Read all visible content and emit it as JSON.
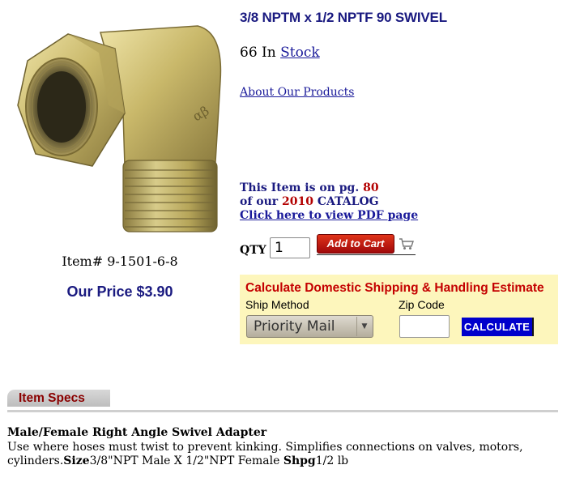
{
  "product": {
    "title": "3/8 NPTM x 1/2 NPTF 90 SWIVEL",
    "stock_count": "66 In",
    "stock_link": "Stock",
    "about_link": "About Our Products",
    "item_number": "Item# 9-1501-6-8",
    "price": "Our Price $3.90"
  },
  "catalog": {
    "line1_prefix": "This Item is on  pg.",
    "page": "80",
    "line2_prefix": "of our",
    "year": "2010",
    "line2_suffix": "CATALOG",
    "pdf_link": "Click here to view PDF page"
  },
  "cart": {
    "qty_label": "QTY",
    "qty_value": "1",
    "add_to_cart_label": "Add to Cart"
  },
  "shipping": {
    "title": "Calculate Domestic Shipping & Handling Estimate",
    "method_label": "Ship Method",
    "zip_label": "Zip Code",
    "method_value": "Priority Mail",
    "zip_value": "",
    "calculate_label": "CALCULATE"
  },
  "specs": {
    "tab_label": "Item Specs",
    "heading": "Male/Female Right Angle Swivel Adapter",
    "description": "Use where hoses must twist to prevent kinking. Simplifies connections on valves, motors, cylinders.",
    "size_label": "Size",
    "size_value": "3/8\"NPT Male X 1/2\"NPT Female",
    "shpg_label": "Shpg",
    "shpg_value": "1/2 lb"
  },
  "colors": {
    "title_blue": "#1a1a80",
    "catalog_red": "#b30000",
    "ship_panel_bg": "#fdf6bc",
    "ship_title_red": "#c40000",
    "calculate_bg": "#0000cc",
    "tab_text": "#8a0000"
  },
  "icons": {
    "cart": "shopping-cart-icon",
    "select_arrow": "chevron-down-icon"
  }
}
